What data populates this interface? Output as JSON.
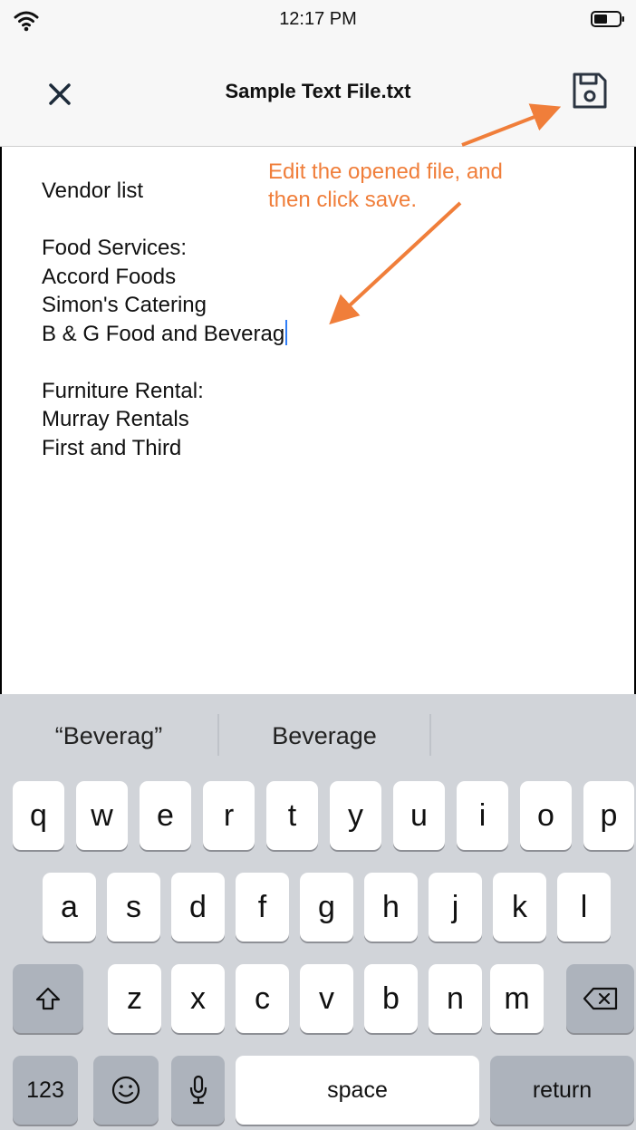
{
  "status_bar": {
    "time": "12:17 PM",
    "icons": [
      "wifi-icon",
      "battery-icon"
    ]
  },
  "nav": {
    "title": "Sample Text File.txt",
    "close_icon": "close-icon",
    "save_icon": "save-icon"
  },
  "editor": {
    "lines": [
      "Vendor list",
      "",
      "Food Services:",
      "Accord Foods",
      "Simon's Catering",
      "B & G Food and Beverag",
      "",
      "Furniture Rental:",
      "Murray Rentals",
      "First and Third"
    ]
  },
  "annotation": {
    "line1": "Edit the opened file, and",
    "line2": "then click save.",
    "color": "#f07e3a"
  },
  "keyboard": {
    "suggestions": [
      "“Beverag”",
      "Beverage",
      ""
    ],
    "row1": [
      "q",
      "w",
      "e",
      "r",
      "t",
      "y",
      "u",
      "i",
      "o",
      "p"
    ],
    "row2": [
      "a",
      "s",
      "d",
      "f",
      "g",
      "h",
      "j",
      "k",
      "l"
    ],
    "row3": [
      "z",
      "x",
      "c",
      "v",
      "b",
      "n",
      "m"
    ],
    "numbers_label": "123",
    "space_label": "space",
    "return_label": "return",
    "icons": [
      "shift-icon",
      "backspace-icon",
      "emoji-icon",
      "microphone-icon"
    ]
  },
  "colors": {
    "accent": "#f07e3a",
    "cursor": "#2f7df6",
    "keyboard_bg": "#d1d4d9",
    "dark_key": "#adb3bc"
  }
}
